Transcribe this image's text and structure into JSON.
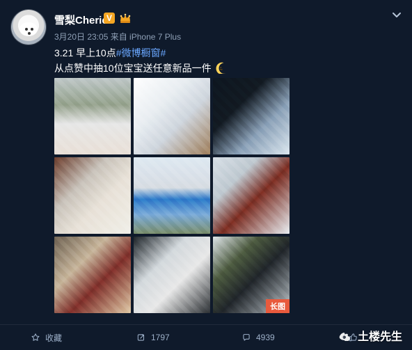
{
  "post": {
    "author": "雪梨Cherie",
    "verified_badge": "V",
    "meta": "3月20日 23:05 来自 iPhone 7 Plus",
    "text_line1_prefix": "3.21 早上10点",
    "topic": "#微博橱窗#",
    "text_line2": "从点赞中抽10位宝宝送任意新品一件",
    "long_image_tag": "长图"
  },
  "actions": {
    "favorite_label": "收藏",
    "repost_count": "1797",
    "comment_count": "4939"
  },
  "watermark": {
    "text": "土楼先生"
  },
  "colors": {
    "background": "#0f1a2b",
    "link": "#6aa7ff",
    "verified": "#f5a623",
    "long_image_tag": "#e85a3d"
  },
  "icons": {
    "more": "chevron-down-icon",
    "crown": "crown-icon",
    "moon": "moon-emoji-icon",
    "favorite": "star-icon",
    "repost": "repost-icon",
    "comment": "comment-icon",
    "like": "thumbs-up-icon",
    "watermark_logo": "weibo-logo-icon"
  }
}
